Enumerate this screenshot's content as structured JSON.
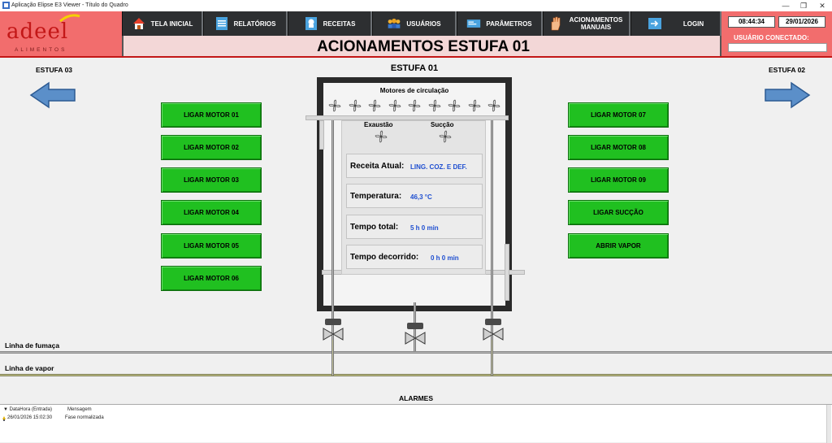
{
  "window": {
    "title": "Aplicação Elipse E3 Viewer - Título do Quadro",
    "minimize": "—",
    "restore": "❐",
    "close": "✕"
  },
  "logo": {
    "brand": "adeel",
    "sub": "ALIMENTOS"
  },
  "nav": [
    {
      "label": "TELA INICIAL",
      "icon": "home-icon"
    },
    {
      "label": "RELATÓRIOS",
      "icon": "report-icon"
    },
    {
      "label": "RECEITAS",
      "icon": "chef-icon"
    },
    {
      "label": "USUÁRIOS",
      "icon": "users-icon"
    },
    {
      "label": "PARÂMETROS",
      "icon": "parameters-icon"
    },
    {
      "label": "ACIONAMENTOS MANUAIS",
      "icon": "hand-icon"
    },
    {
      "label": "LOGIN",
      "icon": "login-icon"
    }
  ],
  "clock": {
    "time": "08:44:34",
    "date": "29/01/2026"
  },
  "user": {
    "label": "USUÁRIO CONECTADO:",
    "value": ""
  },
  "page": {
    "title": "ACIONAMENTOS ESTUFA 01"
  },
  "navigation": {
    "prev": "ESTUFA 03",
    "next": "ESTUFA 02"
  },
  "left_buttons": [
    "LIGAR MOTOR 01",
    "LIGAR MOTOR 02",
    "LIGAR MOTOR 03",
    "LIGAR MOTOR 04",
    "LIGAR MOTOR 05",
    "LIGAR MOTOR 06"
  ],
  "right_buttons": [
    "LIGAR MOTOR 07",
    "LIGAR MOTOR 08",
    "LIGAR MOTOR 09",
    "LIGAR SUCÇÃO",
    "ABRIR VAPOR"
  ],
  "estufa": {
    "title": "ESTUFA 01",
    "motors_label": "Motores de circulação",
    "exhaust_label": "Exaustão",
    "suction_label": "Sucção",
    "recipe_label": "Receita Atual:",
    "recipe_value": "LING. COZ. E DEF.",
    "temp_label": "Temperatura:",
    "temp_value": "46,3 °C",
    "total_label": "Tempo total:",
    "total_value": "5 h 0 min",
    "elapsed_label": "Tempo decorrido:",
    "elapsed_value": "0 h 0 min"
  },
  "lines": {
    "smoke": "Linha de fumaça",
    "steam": "Linha de vapor"
  },
  "alarms": {
    "title": "ALARMES",
    "col_datetime": "▼ DataHora (Entrada)",
    "col_message": "Mensagem",
    "rows": [
      {
        "datetime": "26/01/2026 15:02:30",
        "message": "Fase normalizada"
      }
    ]
  },
  "colors": {
    "header": "#f26d6d",
    "nav": "#2d2f31",
    "button_green": "#20c020",
    "value_blue": "#1f4fd0"
  }
}
